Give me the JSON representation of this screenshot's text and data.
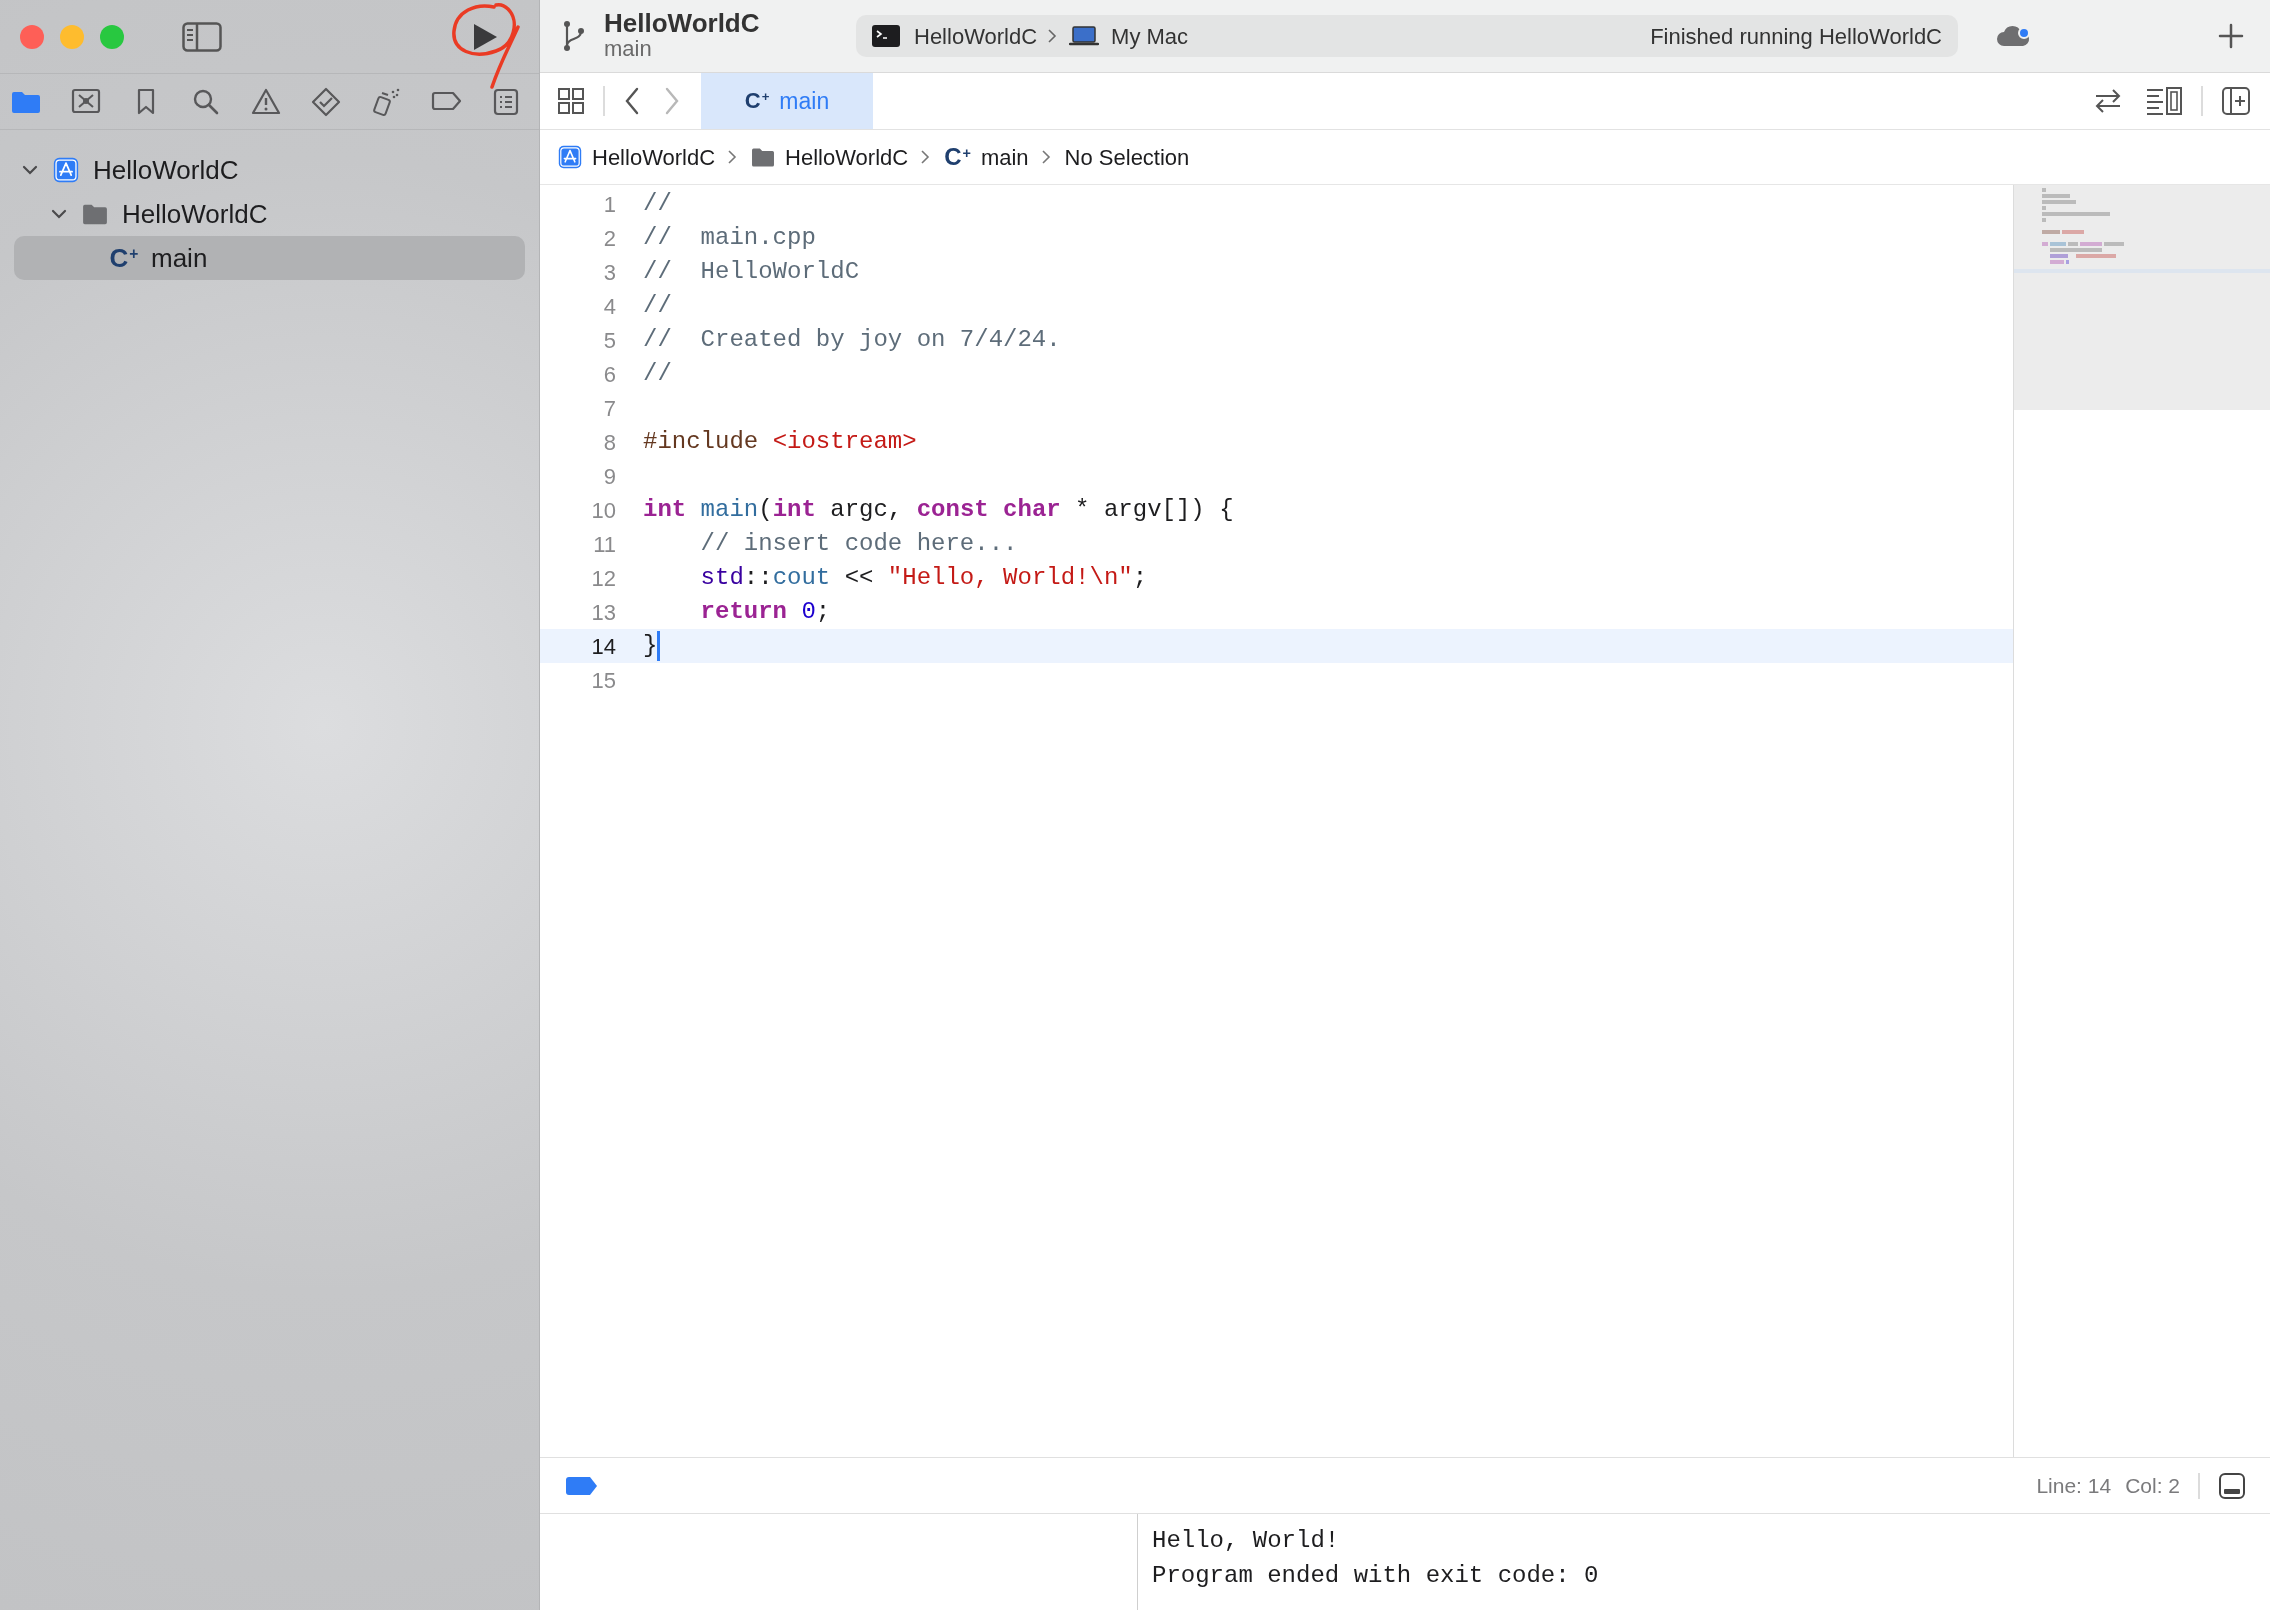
{
  "toolbar": {
    "project": "HelloWorldC",
    "branch": "main",
    "scheme": {
      "target": "HelloWorldC",
      "destination": "My Mac"
    },
    "status": "Finished running HelloWorldC"
  },
  "navigator_tabs": [
    {
      "kind": "folder",
      "selected": true
    },
    {
      "kind": "source-control",
      "selected": false
    },
    {
      "kind": "bookmark",
      "selected": false
    },
    {
      "kind": "search",
      "selected": false
    },
    {
      "kind": "warning",
      "selected": false
    },
    {
      "kind": "test",
      "selected": false
    },
    {
      "kind": "debug",
      "selected": false
    },
    {
      "kind": "breakpoint",
      "selected": false
    },
    {
      "kind": "report",
      "selected": false
    }
  ],
  "navigator_tree": [
    {
      "kind": "project",
      "label": "HelloWorldC",
      "expanded": true,
      "selected": false,
      "children": [
        {
          "kind": "folder",
          "label": "HelloWorldC",
          "expanded": true,
          "selected": false,
          "children": [
            {
              "kind": "source",
              "type_glyph": "C$^{+}$",
              "label": "main",
              "selected": true
            }
          ]
        }
      ]
    }
  ],
  "history": {
    "back": {
      "disabled": false
    },
    "forward": {
      "disabled": true
    }
  },
  "editor_tabs": [
    {
      "type_glyph": "C$^{+}$",
      "label": "main",
      "selected": true
    }
  ],
  "breadcrumb": [
    {
      "kind": "project",
      "label": "HelloWorldC"
    },
    {
      "kind": "folder",
      "label": "HelloWorldC"
    },
    {
      "kind": "source",
      "type_glyph": "C$^{+}$",
      "label": "main"
    },
    {
      "kind": "plain",
      "label": "No Selection"
    }
  ],
  "code": {
    "lines": [
      {
        "number": "1",
        "current": false,
        "tokens": [
          {
            "kind": "comment",
            "text": "//"
          }
        ]
      },
      {
        "number": "2",
        "current": false,
        "tokens": [
          {
            "kind": "comment",
            "text": "//  main.cpp"
          }
        ]
      },
      {
        "number": "3",
        "current": false,
        "tokens": [
          {
            "kind": "comment",
            "text": "//  HelloWorldC"
          }
        ]
      },
      {
        "number": "4",
        "current": false,
        "tokens": [
          {
            "kind": "comment",
            "text": "//"
          }
        ]
      },
      {
        "number": "5",
        "current": false,
        "tokens": [
          {
            "kind": "comment",
            "text": "//  Created by joy on 7/4/24."
          }
        ]
      },
      {
        "number": "6",
        "current": false,
        "tokens": [
          {
            "kind": "comment",
            "text": "//"
          }
        ]
      },
      {
        "number": "7",
        "current": false
      },
      {
        "number": "8",
        "current": false,
        "tokens": [
          {
            "kind": "preprocessor",
            "text": "#include "
          },
          {
            "kind": "string",
            "text": "<iostream>"
          }
        ]
      },
      {
        "number": "9",
        "current": false
      },
      {
        "number": "10",
        "current": false,
        "tokens": [
          {
            "kind": "keyword",
            "text": "int"
          },
          {
            "kind": "function",
            "text": " main"
          },
          {
            "kind": "plain",
            "text": "("
          },
          {
            "kind": "keyword",
            "text": "int"
          },
          {
            "kind": "plain",
            "text": " argc, "
          },
          {
            "kind": "keyword",
            "text": "const"
          },
          {
            "kind": "keyword",
            "text": " char"
          },
          {
            "kind": "plain",
            "text": " * argv[]) {"
          }
        ]
      },
      {
        "number": "11",
        "current": false,
        "tokens": [
          {
            "kind": "comment",
            "text": "    // insert code here..."
          }
        ]
      },
      {
        "number": "12",
        "current": false,
        "tokens": [
          {
            "kind": "namespace",
            "text": "    std"
          },
          {
            "kind": "plain",
            "text": "::"
          },
          {
            "kind": "function",
            "text": "cout"
          },
          {
            "kind": "plain",
            "text": " << "
          },
          {
            "kind": "string",
            "text": "\"Hello, World!\\n\""
          },
          {
            "kind": "plain",
            "text": ";"
          }
        ]
      },
      {
        "number": "13",
        "current": false,
        "tokens": [
          {
            "kind": "keyword",
            "text": "    return"
          },
          {
            "kind": "number",
            "text": " 0"
          },
          {
            "kind": "plain",
            "text": ";"
          }
        ]
      },
      {
        "number": "14",
        "current": true,
        "tokens": [
          {
            "kind": "plain",
            "text": "}"
          }
        ]
      },
      {
        "number": "15",
        "current": false
      }
    ]
  },
  "status_bar": {
    "line": "Line: 14",
    "column": "Col: 2"
  },
  "console": {
    "output": [
      "Hello, World!",
      "Program ended with exit code: 0"
    ]
  }
}
